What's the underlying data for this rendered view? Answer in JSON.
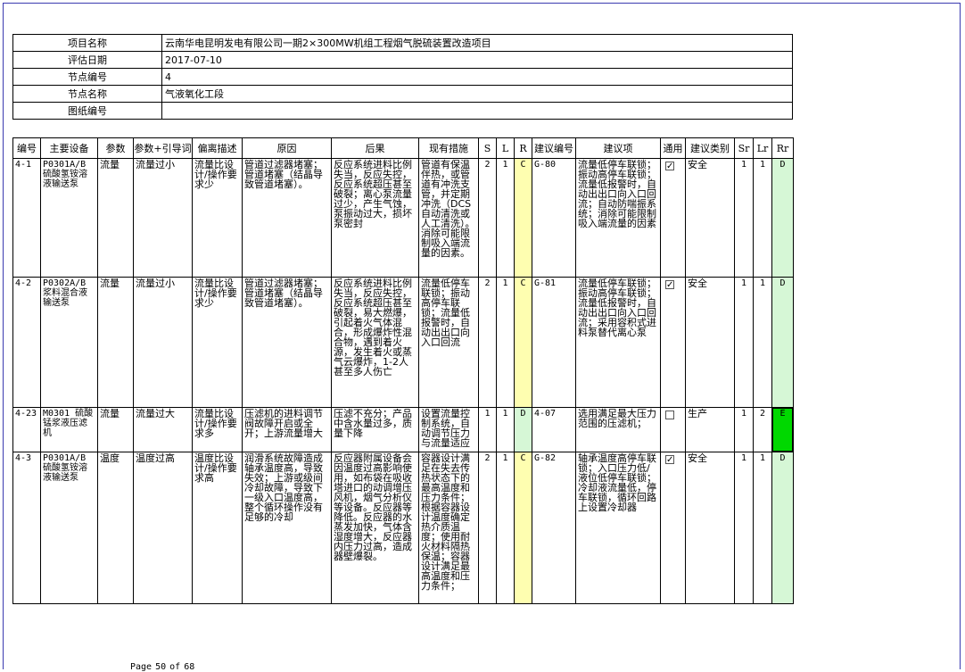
{
  "info": [
    {
      "label": "项目名称",
      "value": "云南华电昆明发电有限公司一期2×300MW机组工程烟气脱硫装置改造项目"
    },
    {
      "label": "评估日期",
      "value": "2017-07-10"
    },
    {
      "label": "节点编号",
      "value": "4"
    },
    {
      "label": "节点名称",
      "value": "气液氧化工段"
    },
    {
      "label": "图纸编号",
      "value": ""
    }
  ],
  "headers": [
    "编号",
    "主要设备",
    "参数",
    "参数+引导词",
    "偏离描述",
    "原因",
    "后果",
    "现有措施",
    "S",
    "L",
    "R",
    "建议编号",
    "建议项",
    "通用",
    "建议类别",
    "Sr",
    "Lr",
    "Rr"
  ],
  "rows": [
    {
      "id": "4-1",
      "equipment": "P0301A/B 硫酸氢铵溶液输送泵",
      "param": "流量",
      "param_guide": "流量过小",
      "deviation": "流量比设计/操作要求少",
      "cause": "管道过滤器堵塞；管道堵塞（结晶导致管道堵塞）。",
      "consequence": "反应系统进料比例失当，反应失控，反应系统超压甚至破裂；离心泵流量过少，产生气蚀，泵振动过大，损坏泵密封",
      "measures": "管道有保温伴热，或管道有冲洗支管，并定期冲洗（DCS自动清洗或人工清洗）。消除可能限制吸入端流量的因素。",
      "s": "2",
      "l": "1",
      "r": "C",
      "rec_no": "G-80",
      "recommendation": "流量低停车联锁；振动高停车联锁；流量低报警时，自动出出口向入口回流；自动防喘振系统；消除可能限制吸入端流量的因素",
      "general": true,
      "category": "安全",
      "sr": "1",
      "lr": "1",
      "rr": "D"
    },
    {
      "id": "4-2",
      "equipment": "P0302A/B 浆料混合液输送泵",
      "param": "流量",
      "param_guide": "流量过小",
      "deviation": "流量比设计/操作要求少",
      "cause": "管道过滤器堵塞；管道堵塞（结晶导致管道堵塞）。",
      "consequence": "反应系统进料比例失当，反应失控，反应系统超压甚至破裂，易大燃爆，引起着火气体混合，形成爆炸性混合物，遇到着火源，发生着火或蒸气云爆炸，1-2人甚至多人伤亡",
      "measures": "流量低停车联锁；振动高停车联锁；流量低报警时，自动出出口向入口回流",
      "s": "2",
      "l": "1",
      "r": "C",
      "rec_no": "G-81",
      "recommendation": "流量低停车联锁；振动高停车联锁；流量低报警时，自动出出口向入口回流；采用容积式进料泵替代离心泵",
      "general": true,
      "category": "安全",
      "sr": "1",
      "lr": "1",
      "rr": "D"
    },
    {
      "id": "4-23",
      "equipment": "M0301 硫酸锰浆液压滤机",
      "param": "流量",
      "param_guide": "流量过大",
      "deviation": "流量比设计/操作要求多",
      "cause": "压滤机的进料调节阀故障开启或全开；上游流量增大",
      "consequence": "压滤不充分；产品中含水量过多，质量下降",
      "measures": "设置流量控制系统，自动调节压力与流量适应",
      "s": "1",
      "l": "1",
      "r": "D",
      "rec_no": "4-07",
      "recommendation": "选用满足最大压力范围的压滤机；",
      "general": false,
      "category": "生产",
      "sr": "1",
      "lr": "2",
      "rr": "E"
    },
    {
      "id": "4-3",
      "equipment": "P0301A/B 硫酸氢铵溶液输送泵",
      "param": "温度",
      "param_guide": "温度过高",
      "deviation": "温度比设计/操作要求高",
      "cause": "润滑系统故障造成轴承温度高，导致失效；上游或级间冷却故障，导致下一级入口温度高，整个循环操作没有足够的冷却",
      "consequence": "反应器附属设备会因温度过高影响使用，如布袋在吸收塔进口的动调增压风机，烟气分析仪等设备。反应器等降低。反应器的水蒸发加快，气体含湿度增大，反应器内压力过高，造成器壁爆裂。",
      "measures": "容器设计满足在失去传热状态下的最高温度和压力条件；根据容器设计温度确定热介质温度；使用耐火材料隔热保温；容器设计满足最高温度和压力条件；",
      "s": "2",
      "l": "1",
      "r": "C",
      "rec_no": "G-82",
      "recommendation": "轴承温度高停车联锁；入口压力低/液位低停车联锁；冷却液流量低，停车联锁，循环回路上设置冷却器",
      "general": true,
      "category": "安全",
      "sr": "1",
      "lr": "1",
      "rr": "D"
    }
  ],
  "footer": {
    "page_word": "Page",
    "page": "50",
    "of_word": "of",
    "total": "68"
  },
  "colors": {
    "risk_C": "#fefeb0",
    "risk_D": "#d6f7d6",
    "risk_E": "#00d800",
    "border": "#000000",
    "frame": "#3a3ab0"
  }
}
